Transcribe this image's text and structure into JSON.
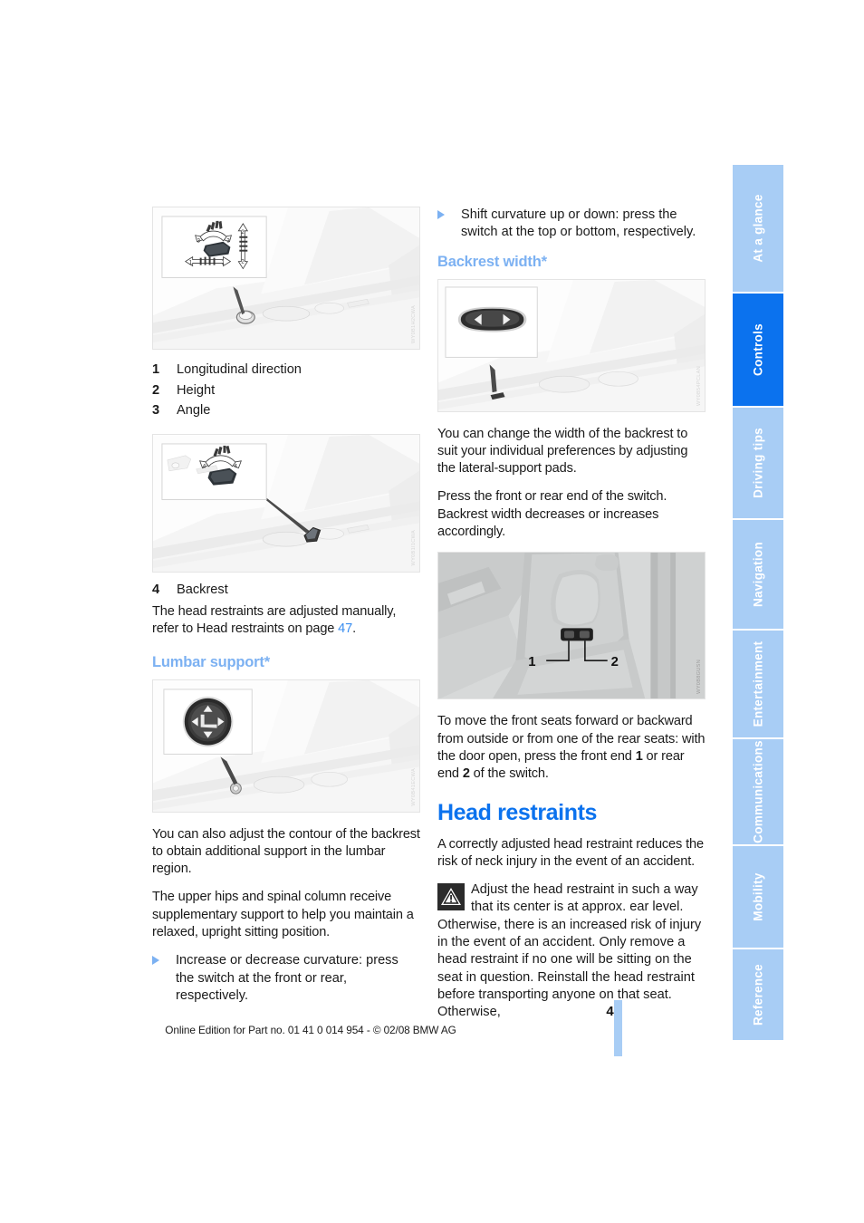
{
  "page": {
    "number": "47",
    "footer_note": "Online Edition for Part no. 01 41 0 014 954  - © 02/08 BMW AG"
  },
  "colors": {
    "heading_primary": "#0b72ee",
    "heading_secondary": "#7cb1f2",
    "tab_inactive": "#a8cdf5",
    "tab_active": "#0b72ee",
    "link": "#3a8ef0"
  },
  "sidebar": {
    "tabs": [
      {
        "label": "At a glance",
        "active": false
      },
      {
        "label": "Controls",
        "active": true
      },
      {
        "label": "Driving tips",
        "active": false
      },
      {
        "label": "Navigation",
        "active": false
      },
      {
        "label": "Entertainment",
        "active": false
      },
      {
        "label": "Communications",
        "active": false
      },
      {
        "label": "Mobility",
        "active": false
      },
      {
        "label": "Reference",
        "active": false
      }
    ]
  },
  "left_column": {
    "figure_seat_switch": {
      "code": "WY0B1H2CWA",
      "alt": "Seat adjustment switch on door panel with longitudinal, height and angle arrows"
    },
    "legend_seat": [
      {
        "num": "1",
        "text": "Longitudinal direction"
      },
      {
        "num": "2",
        "text": "Height"
      },
      {
        "num": "3",
        "text": "Angle"
      }
    ],
    "figure_backrest_switch": {
      "code": "WY0B1I1CWA",
      "alt": "Backrest angle adjustment switch on door panel"
    },
    "legend_backrest": [
      {
        "num": "4",
        "text": "Backrest"
      }
    ],
    "head_restraint_note_pre": "The head restraints are adjusted manually, refer to Head restraints on page ",
    "head_restraint_note_link": "47",
    "head_restraint_note_post": ".",
    "lumbar_heading": "Lumbar support*",
    "figure_lumbar": {
      "code": "WY0B41ECWA",
      "alt": "Four-way lumbar support rocker switch on door panel"
    },
    "para_1": "You can also adjust the contour of the backrest to obtain additional support in the lumbar region.",
    "para_2": "The upper hips and spinal column receive supplementary support to help you maintain a relaxed, upright sitting position.",
    "bullet_1": "Increase or decrease curvature: press the switch at the front or rear, respectively."
  },
  "right_column": {
    "bullet_1": "Shift curvature up or down: press the switch at the top or bottom, respectively.",
    "backrest_width_heading": "Backrest width*",
    "figure_backrest_width": {
      "code": "WY0B54PCLAN",
      "alt": "Backrest width rocker switch with left and right arrows on door panel"
    },
    "para_1": "You can change the width of the backrest to suit your individual preferences by adjusting the lateral-support pads.",
    "para_2_line1": "Press the front or rear end of the switch.",
    "para_2_line2": "Backrest width decreases or increases accordingly.",
    "figure_outside_switch": {
      "code": "WY0B8GUSN",
      "alt": "Seat fore/aft switch on outer side of front seat backrest",
      "labels": [
        {
          "num": "1"
        },
        {
          "num": "2"
        }
      ]
    },
    "para_3": {
      "t1": "To move the front seats forward or backward from outside or from one of the rear seats: with the door open, press the front end ",
      "b1": "1",
      "t2": " or rear end ",
      "b2": "2",
      "t3": " of the switch."
    },
    "head_restraints_heading": "Head restraints",
    "para_4": "A correctly adjusted head restraint reduces the risk of neck injury in the event of an accident.",
    "warning": {
      "icon": "warning-triangle-icon",
      "text": "Adjust the head restraint in such a way that its center is at approx. ear level. Otherwise, there is an increased risk of injury in the event of an accident. Only remove a head restraint if no one will be sitting on the seat in question. Reinstall the head restraint before transporting anyone on that seat. Otherwise,"
    }
  }
}
